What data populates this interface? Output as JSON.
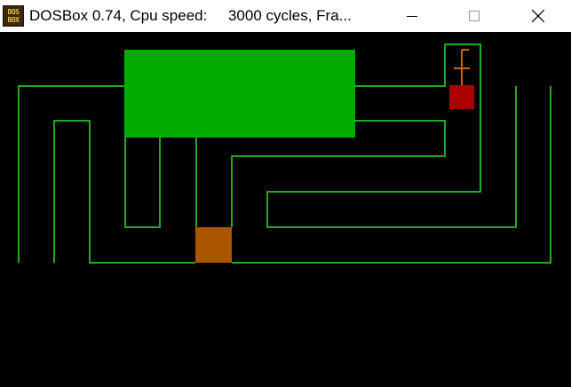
{
  "window": {
    "title": "DOSBox 0.74, Cpu speed:     3000 cycles, Fra...",
    "icon_text_top": "DOS",
    "icon_text_bottom": "BOX",
    "icon": "dosbox-icon",
    "controls": [
      "minimize-icon",
      "maximize-icon",
      "close-icon"
    ]
  },
  "game": {
    "background_color": "#000000",
    "track_color": "#22aa22",
    "box_color": "#00aa00",
    "player_color": "#aa5500",
    "target_color": "#aa0000",
    "marker_color": "#cc6600"
  }
}
